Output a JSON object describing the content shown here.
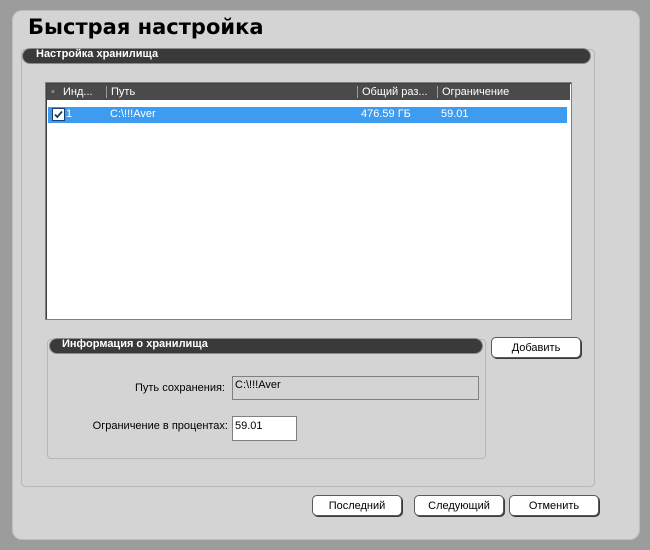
{
  "title": "Быстрая настройка",
  "storage_group": {
    "label": "Настройка хранилища"
  },
  "list": {
    "columns": [
      "Инд...",
      "Путь",
      "Общий раз...",
      "Ограничение"
    ],
    "rows": [
      {
        "checked": true,
        "index": "1",
        "path": "C:\\!!!Aver",
        "size": "476.59 ГБ",
        "limit": "59.01"
      }
    ]
  },
  "info_group": {
    "label": "Информация о хранилища",
    "save_path_label": "Путь сохранения:",
    "save_path_value": "C:\\!!!Aver",
    "limit_label": "Ограничение в процентах:",
    "limit_value": "59.01"
  },
  "buttons": {
    "add": "Добавить",
    "last": "Последний",
    "next": "Следующий",
    "cancel": "Отменить"
  },
  "colors": {
    "selection": "#3d9bf0",
    "header_bg": "#3a3a3a",
    "window_bg": "#d4d4d4"
  }
}
